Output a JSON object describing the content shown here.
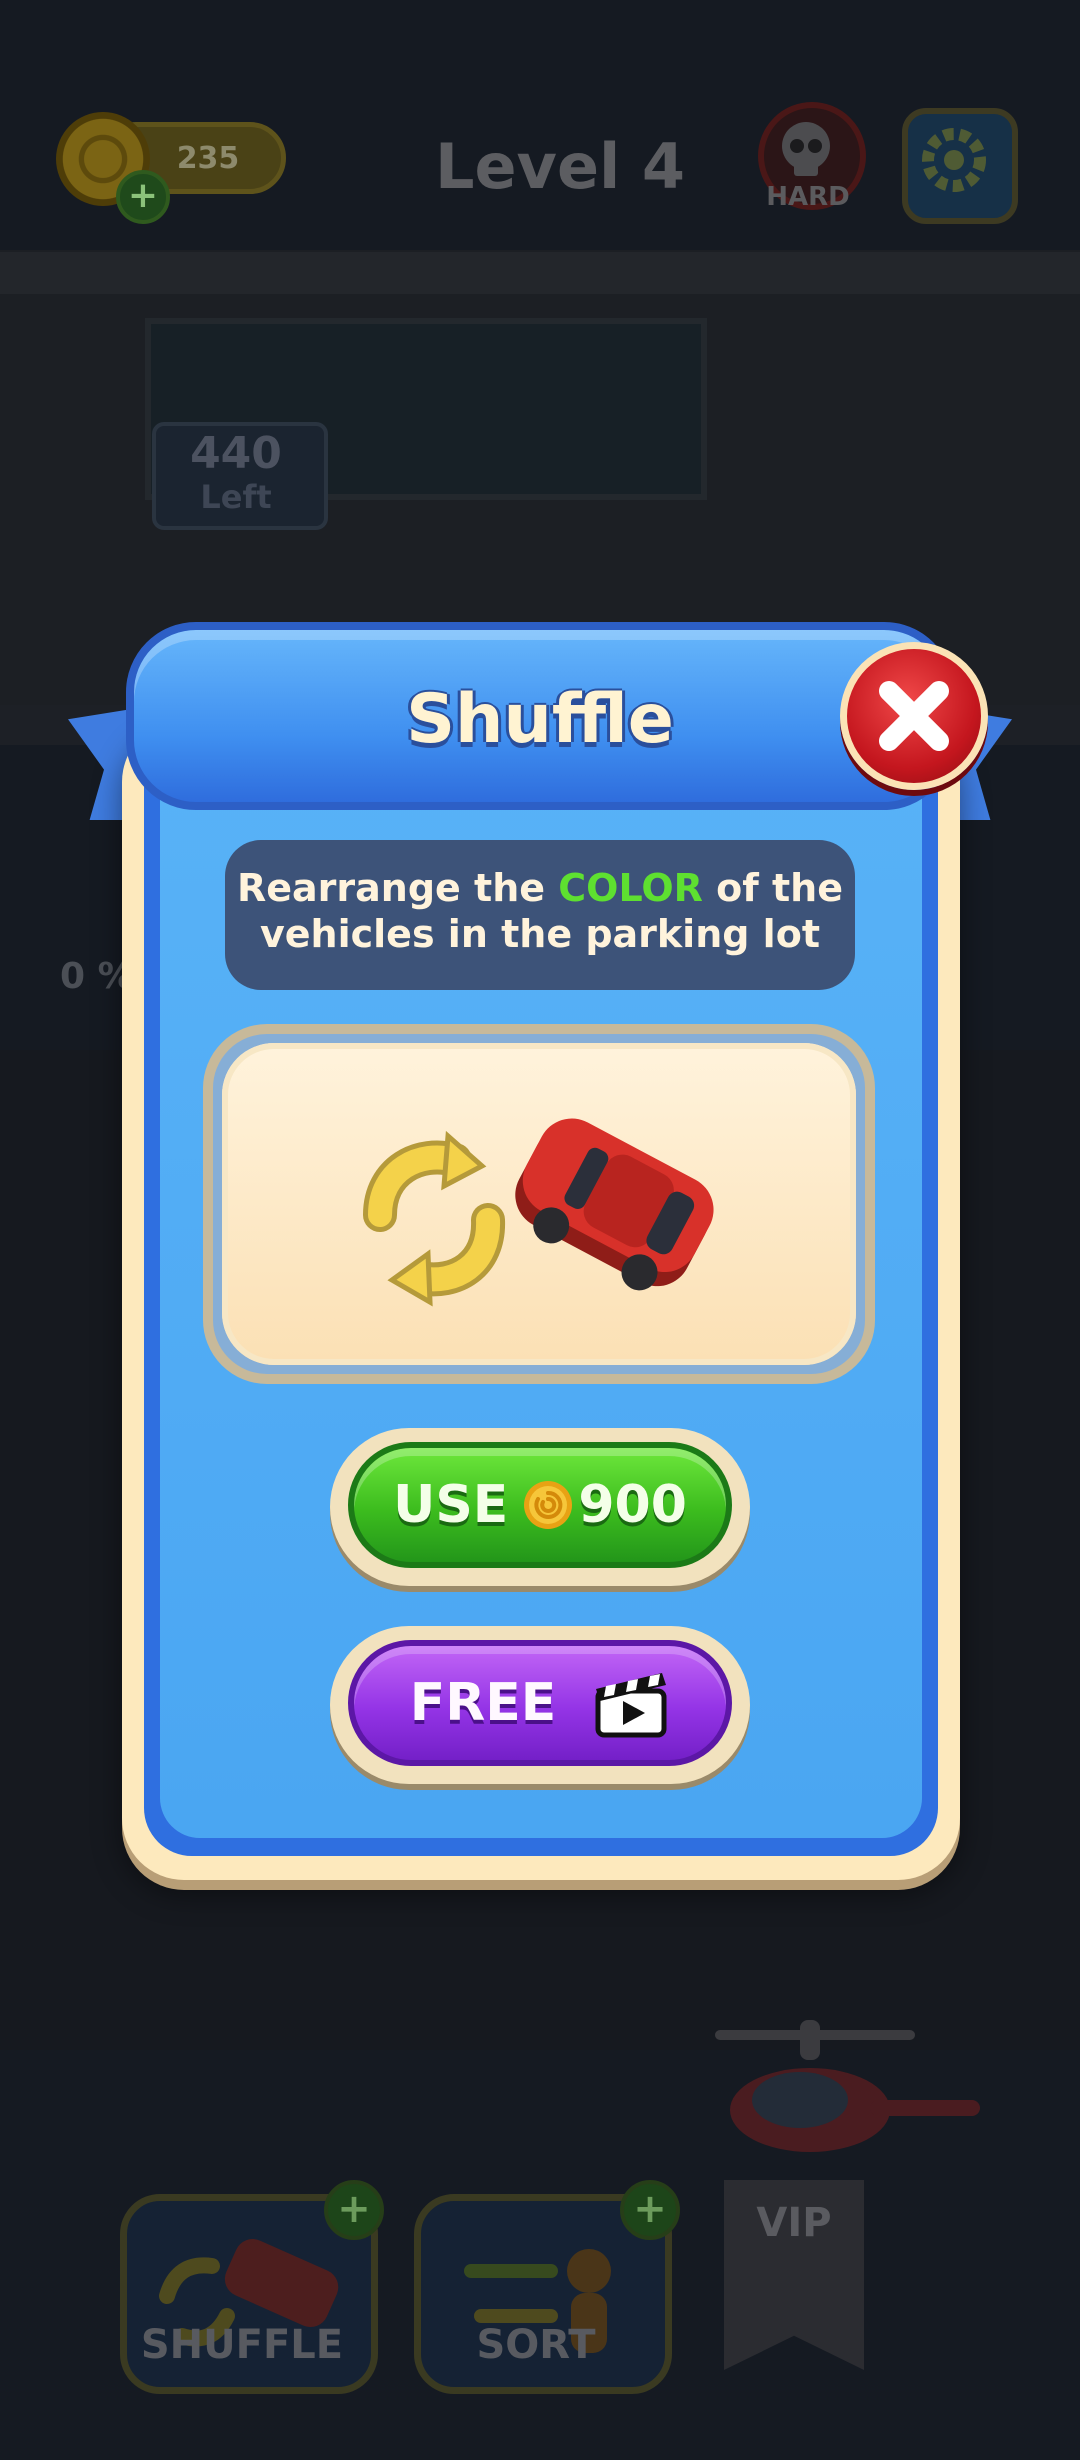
{
  "hud": {
    "coins": "235",
    "level_title": "Level 4",
    "difficulty": "HARD"
  },
  "scene": {
    "remaining_count": "440",
    "remaining_label": "Left",
    "progress": "0 %"
  },
  "boosters": [
    {
      "label": "SHUFFLE"
    },
    {
      "label": "SORT"
    }
  ],
  "vip": {
    "label": "VIP"
  },
  "modal": {
    "title": "Shuffle",
    "description_line1_start": "Rearrange the",
    "description_highlight": "COLOR",
    "description_line1_end": "of the",
    "description_line2": "vehicles in the parking lot",
    "use_label": "USE",
    "use_price": "900",
    "free_label": "FREE"
  },
  "colors": {
    "modal_blue": "#4aa6f2",
    "close_red": "#c4161e",
    "use_green": "#3cbc1e",
    "free_purple": "#9434e6",
    "highlight_green": "#5ee030",
    "car_red": "#d8312a"
  },
  "icons": [
    "coin-icon",
    "plus-icon",
    "skull-icon",
    "gear-icon",
    "close-icon",
    "shuffle-arrows-icon",
    "red-car-icon",
    "video-clapper-icon"
  ]
}
